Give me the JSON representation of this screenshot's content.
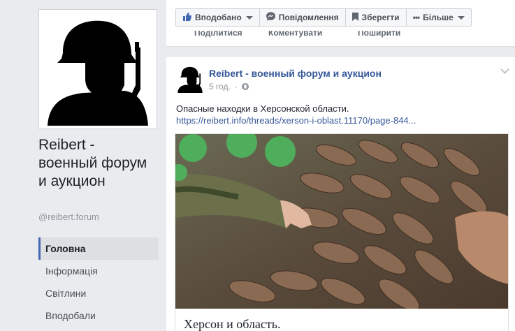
{
  "page": {
    "name": "Reibert - военный форум и аукцион",
    "handle": "@reibert.forum"
  },
  "nav": {
    "items": [
      {
        "label": "Головна",
        "active": true
      },
      {
        "label": "Інформація",
        "active": false
      },
      {
        "label": "Світлини",
        "active": false
      },
      {
        "label": "Вподобали",
        "active": false
      }
    ]
  },
  "actions": {
    "liked": "Вподобано",
    "message": "Повідомлення",
    "save": "Зберегти",
    "more": "Більше"
  },
  "prev_post_actions": {
    "share_partial": "Поділитися",
    "comment_partial": "Коментувати",
    "repost_partial": "Поширити"
  },
  "post": {
    "author": "Reibert - военный форум и аукцион",
    "time": "5 год.",
    "text": "Опасные находки в Херсонской области.",
    "link": "https://reibert.info/threads/xerson-i-oblast.11170/page-844...",
    "attachment_title": "Херсон и область."
  },
  "colors": {
    "link": "#365899",
    "accent": "#4267b2",
    "background": "#e9ebee"
  }
}
